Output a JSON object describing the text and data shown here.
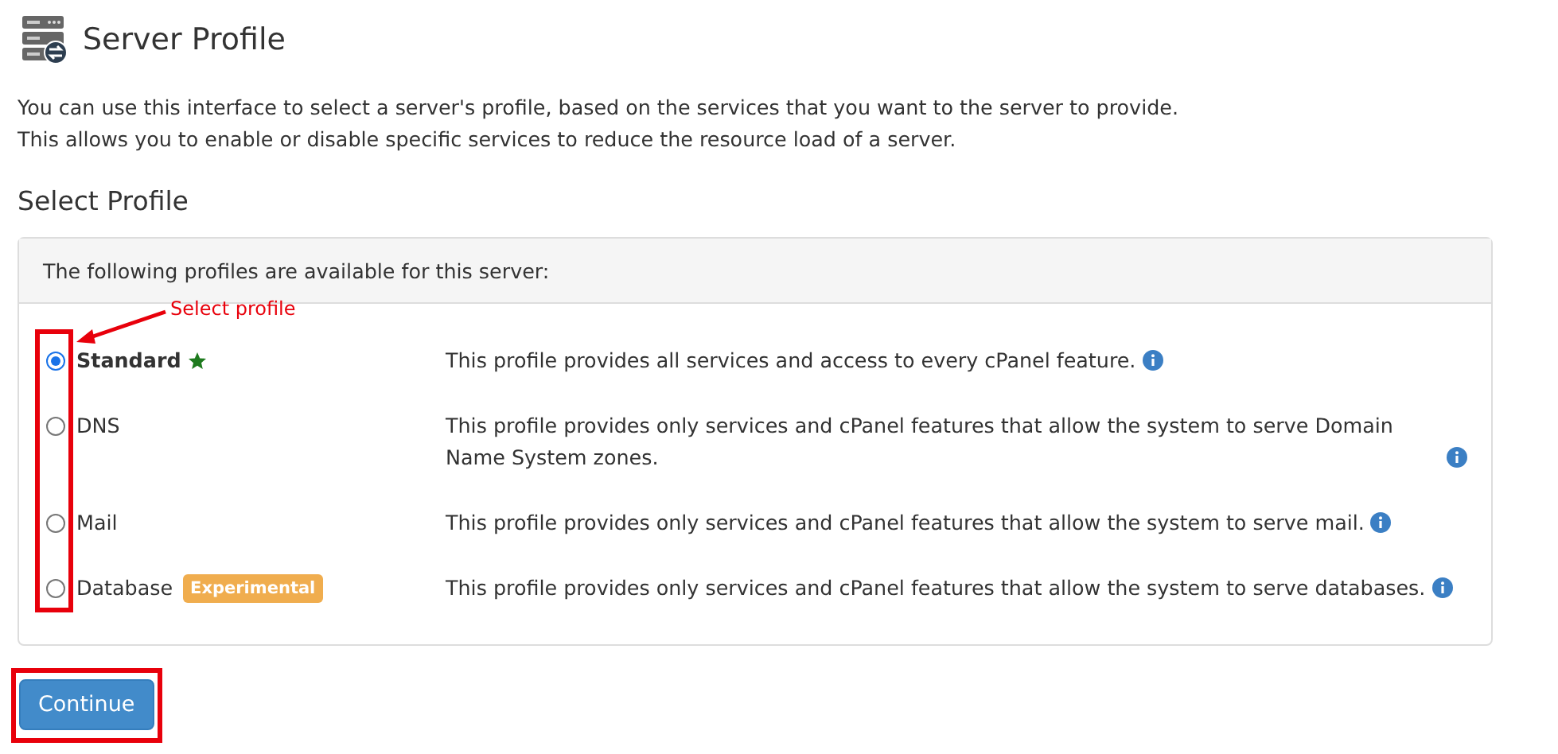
{
  "page": {
    "title": "Server Profile",
    "intro": [
      "You can use this interface to select a server's profile, based on the services that you want to the server to provide.",
      "This allows you to enable or disable specific services to reduce the resource load of a server."
    ]
  },
  "section_title": "Select Profile",
  "panel": {
    "heading": "The following profiles are available for this server:",
    "profiles": [
      {
        "name": "Standard",
        "selected": true,
        "recommended": true,
        "description": "This profile provides all services and access to every cPanel feature."
      },
      {
        "name": "DNS",
        "selected": false,
        "recommended": false,
        "description": "This profile provides only services and cPanel features that allow the system to serve Domain Name System zones."
      },
      {
        "name": "Mail",
        "selected": false,
        "recommended": false,
        "description": "This profile provides only services and cPanel features that allow the system to serve mail."
      },
      {
        "name": "Database",
        "selected": false,
        "recommended": false,
        "badge": "Experimental",
        "description": "This profile provides only services and cPanel features that allow the system to serve databases."
      }
    ]
  },
  "continue_button": "Continue",
  "annotation": {
    "label": "Select profile"
  }
}
